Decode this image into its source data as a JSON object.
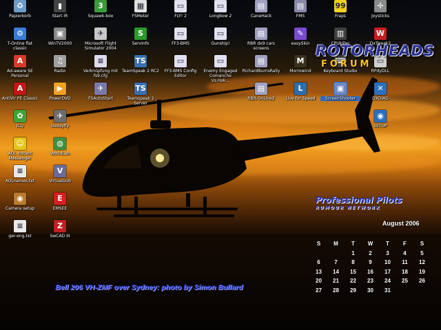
{
  "desktop": {
    "icons": [
      {
        "id": "papierkorb",
        "label": "Papierkorb",
        "icon": "recycle-bin-icon",
        "color": "#6c9bc8",
        "glyph": "♻"
      },
      {
        "id": "t-online-flat",
        "label": "T-Online flat classic",
        "icon": "network-icon",
        "color": "#3a7bd5",
        "glyph": "⚙"
      },
      {
        "id": "ad-aware",
        "label": "Ad-aware SE Personal",
        "icon": "ad-aware-icon",
        "color": "#d83a2a",
        "glyph": "A"
      },
      {
        "id": "antivir",
        "label": "AntiVir PE Classic",
        "icon": "antivir-icon",
        "color": "#c41616",
        "glyph": "A"
      },
      {
        "id": "icq",
        "label": "ICQ",
        "icon": "icq-flower-icon",
        "color": "#3fa33a",
        "glyph": "✿"
      },
      {
        "id": "aol-im",
        "label": "AOL Instant Messenger",
        "icon": "aim-icon",
        "color": "#e5c619",
        "glyph": "☺"
      },
      {
        "id": "aol-names",
        "label": "AOLnames.txt",
        "icon": "text-file-icon",
        "color": "#e8e8e8",
        "glyph": "≡"
      },
      {
        "id": "camera-setup",
        "label": "Camera setup",
        "icon": "camera-icon",
        "color": "#b97a2a",
        "glyph": "◉"
      },
      {
        "id": "ger-eng",
        "label": "ger-eng.txt",
        "icon": "text-file-icon",
        "color": "#e8e8e8",
        "glyph": "≡"
      },
      {
        "id": "start-ir",
        "label": "Start IR",
        "icon": "remote-icon",
        "color": "#444444",
        "glyph": "▮"
      },
      {
        "id": "wintv",
        "label": "WinTV2000",
        "icon": "tv-icon",
        "color": "#888888",
        "glyph": "▣"
      },
      {
        "id": "radio",
        "label": "Radio",
        "icon": "radio-icon",
        "color": "#a0a0a0",
        "glyph": "♫"
      },
      {
        "id": "powerdvd",
        "label": "PowerDVD",
        "icon": "powerdvd-icon",
        "color": "#f0a020",
        "glyph": "▶"
      },
      {
        "id": "buddyfly",
        "label": "buddyfly",
        "icon": "plane-icon",
        "color": "#6d6d6d",
        "glyph": "✈"
      },
      {
        "id": "worldlab",
        "label": "WorldLab",
        "icon": "globe-icon",
        "color": "#3f8f3f",
        "glyph": "◍"
      },
      {
        "id": "virtualdub",
        "label": "VirtualDub",
        "icon": "virtualdub-icon",
        "color": "#6a6a9a",
        "glyph": "V"
      },
      {
        "id": "emsee",
        "label": "EMSEE",
        "icon": "emsee-icon",
        "color": "#d42020",
        "glyph": "E"
      },
      {
        "id": "swcad",
        "label": "SwCAD III",
        "icon": "swcad-icon",
        "color": "#c02020",
        "glyph": "Z"
      },
      {
        "id": "squawkbox",
        "label": "Squawk-box",
        "icon": "squawkbox-icon",
        "color": "#3a9a3a",
        "glyph": "3"
      },
      {
        "id": "msfs",
        "label": "Microsoft Flight Simulator 2004",
        "icon": "flight-sim-icon",
        "color": "#c8c8c8",
        "glyph": "✈"
      },
      {
        "id": "verbindung",
        "label": "Verknüpfung mit fs9.cfg",
        "icon": "shortcut-file-icon",
        "color": "#ddddee",
        "glyph": "≡"
      },
      {
        "id": "fsautostart",
        "label": "FSAutoStart",
        "icon": "fs-auto-icon",
        "color": "#7a7aaa",
        "glyph": "✈"
      },
      {
        "id": "fsmeter",
        "label": "FSMeter",
        "icon": "fsmeter-icon",
        "color": "#e0e0e0",
        "glyph": "▦"
      },
      {
        "id": "servinfo",
        "label": "ServInfo",
        "icon": "servinfo-icon",
        "color": "#2a9a2a",
        "glyph": "S"
      },
      {
        "id": "teamspeak",
        "label": "TeamSpeak 2 RC2",
        "icon": "teamspeak-icon",
        "color": "#3a6fb0",
        "glyph": "TS"
      },
      {
        "id": "teamspeak-server",
        "label": "Teamspeak 2 Server",
        "icon": "teamspeak-icon",
        "color": "#3a6fb0",
        "glyph": "TS"
      },
      {
        "id": "fly2",
        "label": "FLY! 2",
        "icon": "app-window-icon",
        "color": "#e0e0f0",
        "glyph": "▭"
      },
      {
        "id": "ff3-bms",
        "label": "FF3-BMS",
        "icon": "app-window-icon",
        "color": "#e0e0f0",
        "glyph": "▭"
      },
      {
        "id": "ff3-bms-config",
        "label": "FF3-BMS Config Editor",
        "icon": "app-window-icon",
        "color": "#e0e0f0",
        "glyph": "▭"
      },
      {
        "id": "longbow",
        "label": "Longbow 2",
        "icon": "app-window-icon",
        "color": "#e0e0f0",
        "glyph": "▭"
      },
      {
        "id": "gunship",
        "label": "Gunship!",
        "icon": "app-window-icon",
        "color": "#e0e0f0",
        "glyph": "▭"
      },
      {
        "id": "enemy-engaged",
        "label": "Enemy Engaged Comanche Vs.Hok...",
        "icon": "app-window-icon",
        "color": "#e0e0f0",
        "glyph": "▭"
      },
      {
        "id": "cansock",
        "label": "CaneHack",
        "icon": "hardware-icon",
        "color": "#a0a0c0",
        "glyph": "▤"
      },
      {
        "id": "rbr-dx",
        "label": "RBR dx9 cars screens",
        "icon": "rbr-icon",
        "color": "#a0a0c0",
        "glyph": "▤"
      },
      {
        "id": "richardburns",
        "label": "RichardBurnsRally",
        "icon": "rbr-icon",
        "color": "#a0a0c0",
        "glyph": "▤"
      },
      {
        "id": "rbr-online",
        "label": "RBR-OnLine2",
        "icon": "rbr-icon",
        "color": "#a0a0c0",
        "glyph": "▤"
      },
      {
        "id": "fms",
        "label": "FMS",
        "icon": "fms-icon",
        "color": "#8888aa",
        "glyph": "▤"
      },
      {
        "id": "easyskin",
        "label": "easySkin",
        "icon": "easyskin-icon",
        "color": "#7a4ad0",
        "glyph": "✎"
      },
      {
        "id": "morrowind",
        "label": "Morrowind",
        "icon": "morrowind-icon",
        "color": "#3a3020",
        "glyph": "M"
      },
      {
        "id": "livespeed",
        "label": "Live for Speed",
        "icon": "lfs-icon",
        "color": "#2a6fb0",
        "glyph": "L"
      },
      {
        "id": "fraps",
        "label": "Fraps",
        "icon": "fraps-icon",
        "color": "#f0d020",
        "glyph": "99"
      },
      {
        "id": "cpu-killer",
        "label": "CPUkiller",
        "icon": "cpu-icon",
        "color": "#404040",
        "glyph": "▥"
      },
      {
        "id": "keyboard-studio",
        "label": "Keyboard Studio",
        "icon": "keyboard-icon",
        "color": "#3a3a3a",
        "glyph": "⌨"
      },
      {
        "id": "screenshooter",
        "label": "ScreenShooter",
        "icon": "screenshot-icon",
        "color": "#6a88c0",
        "glyph": "▣"
      },
      {
        "id": "joysticks",
        "label": "Joysticks",
        "icon": "joystick-icon",
        "color": "#8a8a8a",
        "glyph": "✢"
      },
      {
        "id": "dxtweak",
        "label": "DxTweak2",
        "icon": "dxtweak-icon",
        "color": "#c42020",
        "glyph": "W"
      },
      {
        "id": "rpdly",
        "label": "RPdyDLL",
        "icon": "dll-icon",
        "color": "#d0d0d0",
        "glyph": "▭"
      },
      {
        "id": "dxdiag",
        "label": "DXDIAG",
        "icon": "dxdiag-icon",
        "color": "#2a70c0",
        "glyph": "✕"
      },
      {
        "id": "setup",
        "label": "SETUP",
        "icon": "setup-icon",
        "color": "#2a70c0",
        "glyph": "◉"
      }
    ]
  },
  "logos": {
    "rotorheads": {
      "line1": "ROTORHEADS",
      "line2": "FORUM"
    },
    "pprune": {
      "line1": "Professional Pilots",
      "line2": "RUMOUR NETWORK"
    }
  },
  "calendar": {
    "title": "August 2006",
    "weekdays": [
      "S",
      "M",
      "T",
      "W",
      "T",
      "F",
      "S"
    ],
    "weeks": [
      [
        "",
        "",
        "1",
        "2",
        "3",
        "4",
        "5"
      ],
      [
        "6",
        "7",
        "8",
        "9",
        "10",
        "11",
        "12"
      ],
      [
        "13",
        "14",
        "15",
        "16",
        "17",
        "18",
        "19"
      ],
      [
        "20",
        "21",
        "22",
        "23",
        "24",
        "25",
        "26"
      ],
      [
        "27",
        "28",
        "29",
        "30",
        "31",
        "",
        ""
      ]
    ]
  },
  "caption": "Bell 206 VH-ZMF over Sydney: photo by Simon Bullard"
}
